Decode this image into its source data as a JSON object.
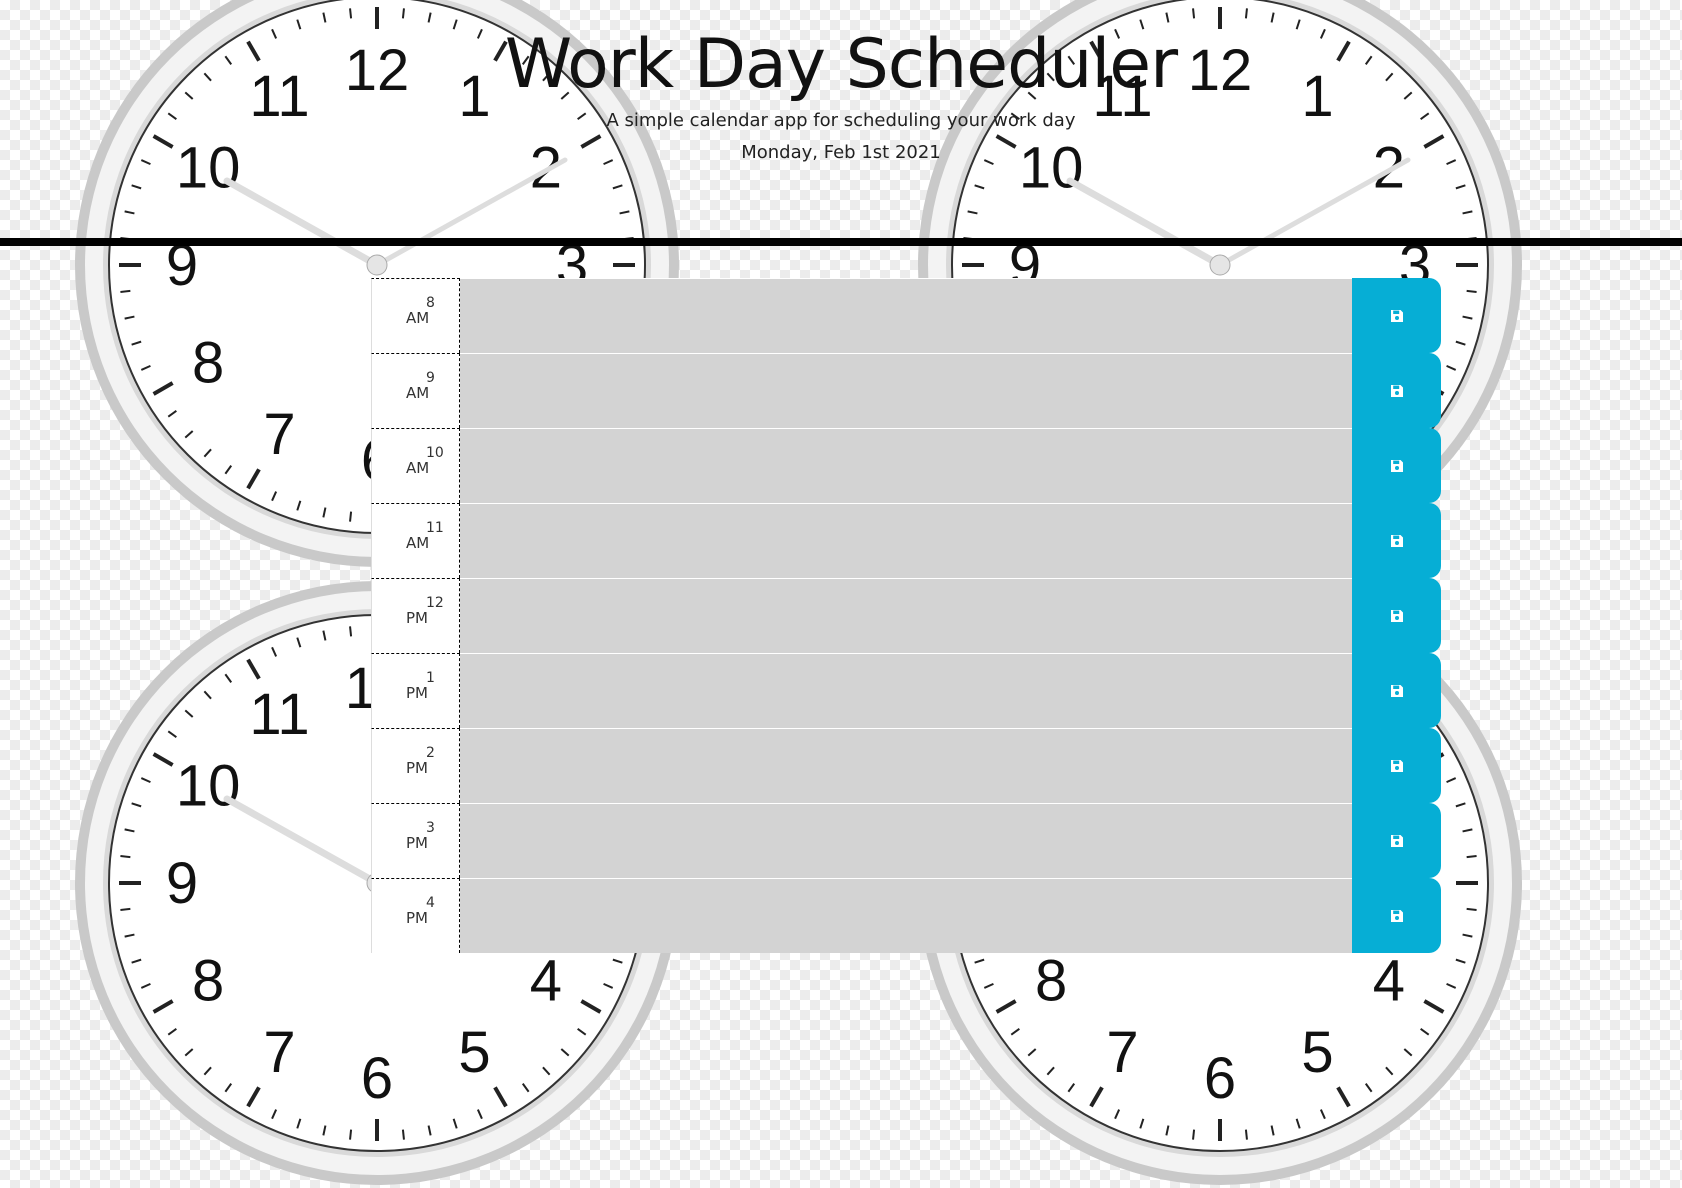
{
  "header": {
    "title": "Work Day Scheduler",
    "lead": "A simple calendar app for scheduling your work day",
    "current_day": "Monday, Feb 1st 2021"
  },
  "colors": {
    "save_button": "#06aed5",
    "text_area": "#d3d3d3",
    "divider": "#000000"
  },
  "save_icon": "floppy-disk-icon",
  "time_blocks": [
    {
      "hour": "8",
      "ampm": "AM",
      "text": ""
    },
    {
      "hour": "9",
      "ampm": "AM",
      "text": ""
    },
    {
      "hour": "10",
      "ampm": "AM",
      "text": ""
    },
    {
      "hour": "11",
      "ampm": "AM",
      "text": ""
    },
    {
      "hour": "12",
      "ampm": "PM",
      "text": ""
    },
    {
      "hour": "1",
      "ampm": "PM",
      "text": ""
    },
    {
      "hour": "2",
      "ampm": "PM",
      "text": ""
    },
    {
      "hour": "3",
      "ampm": "PM",
      "text": ""
    },
    {
      "hour": "4",
      "ampm": "PM",
      "text": ""
    }
  ]
}
